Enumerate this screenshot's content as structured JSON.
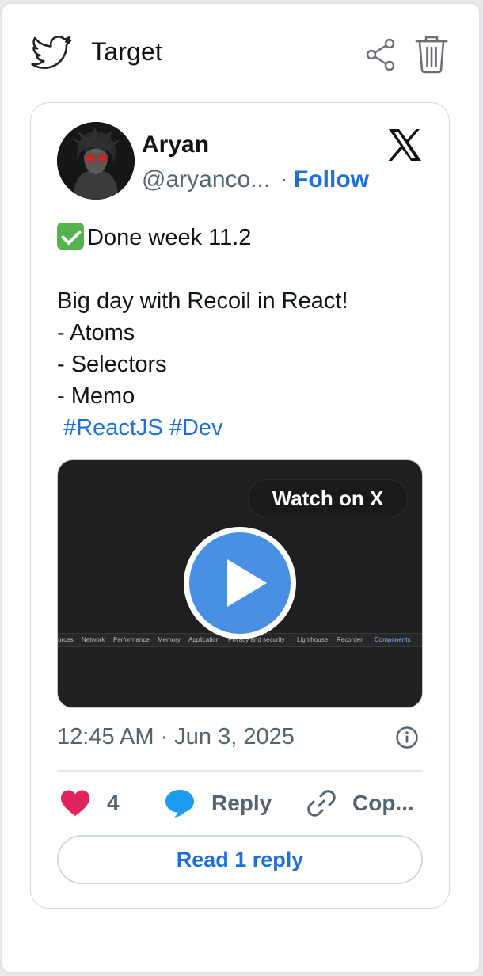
{
  "header": {
    "title": "Target",
    "bird_icon": "twitter-bird-icon",
    "share_icon": "share-icon",
    "trash_icon": "trash-icon"
  },
  "tweet": {
    "author_name": "Aryan",
    "handle": "@aryanco...",
    "separator": "·",
    "follow_label": "Follow",
    "text_lines": [
      "Done week 11.2",
      "",
      "Big day with Recoil in React!",
      "- Atoms",
      "- Selectors",
      "- Memo"
    ],
    "hashtags": [
      "#ReactJS",
      "#Dev"
    ],
    "media": {
      "watch_label": "Watch on X",
      "devtools_tabs": [
        "urces",
        "Network",
        "Performance",
        "Memory",
        "Application",
        "Privacy and security",
        "Lighthouse",
        "Recorder",
        "Components"
      ]
    },
    "timestamp": "12:45 AM · Jun 3, 2025",
    "likes": "4",
    "reply_label": "Reply",
    "copy_label": "Cop...",
    "read_replies_label": "Read 1 reply"
  },
  "colors": {
    "link_blue": "#1d6fd9",
    "like_pink": "#e0245e",
    "reply_blue": "#1d9bf0",
    "muted": "#536471"
  }
}
